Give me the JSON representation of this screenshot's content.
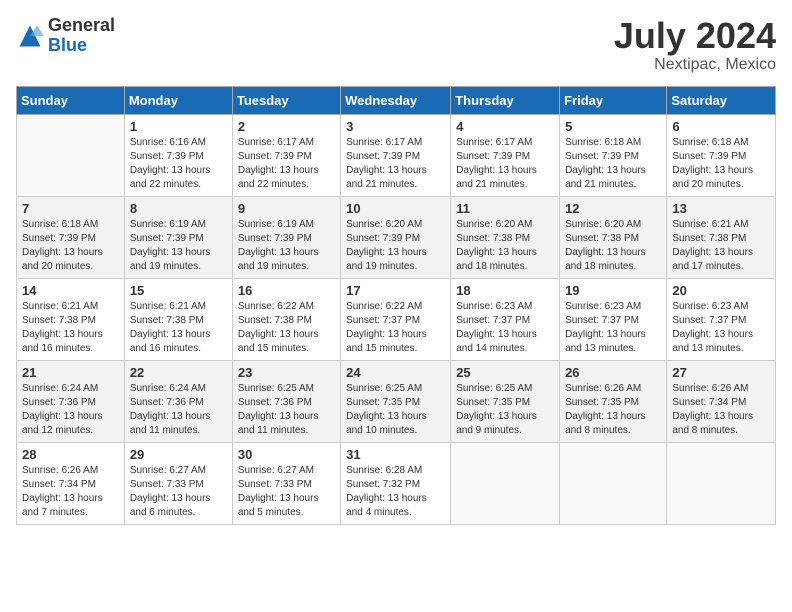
{
  "header": {
    "logo_general": "General",
    "logo_blue": "Blue",
    "month_title": "July 2024",
    "location": "Nextipac, Mexico"
  },
  "days_of_week": [
    "Sunday",
    "Monday",
    "Tuesday",
    "Wednesday",
    "Thursday",
    "Friday",
    "Saturday"
  ],
  "weeks": [
    [
      {
        "day": "",
        "sunrise": "",
        "sunset": "",
        "daylight": ""
      },
      {
        "day": "1",
        "sunrise": "6:16 AM",
        "sunset": "7:39 PM",
        "daylight": "13 hours and 22 minutes."
      },
      {
        "day": "2",
        "sunrise": "6:17 AM",
        "sunset": "7:39 PM",
        "daylight": "13 hours and 22 minutes."
      },
      {
        "day": "3",
        "sunrise": "6:17 AM",
        "sunset": "7:39 PM",
        "daylight": "13 hours and 21 minutes."
      },
      {
        "day": "4",
        "sunrise": "6:17 AM",
        "sunset": "7:39 PM",
        "daylight": "13 hours and 21 minutes."
      },
      {
        "day": "5",
        "sunrise": "6:18 AM",
        "sunset": "7:39 PM",
        "daylight": "13 hours and 21 minutes."
      },
      {
        "day": "6",
        "sunrise": "6:18 AM",
        "sunset": "7:39 PM",
        "daylight": "13 hours and 20 minutes."
      }
    ],
    [
      {
        "day": "7",
        "sunrise": "6:18 AM",
        "sunset": "7:39 PM",
        "daylight": "13 hours and 20 minutes."
      },
      {
        "day": "8",
        "sunrise": "6:19 AM",
        "sunset": "7:39 PM",
        "daylight": "13 hours and 19 minutes."
      },
      {
        "day": "9",
        "sunrise": "6:19 AM",
        "sunset": "7:39 PM",
        "daylight": "13 hours and 19 minutes."
      },
      {
        "day": "10",
        "sunrise": "6:20 AM",
        "sunset": "7:39 PM",
        "daylight": "13 hours and 19 minutes."
      },
      {
        "day": "11",
        "sunrise": "6:20 AM",
        "sunset": "7:38 PM",
        "daylight": "13 hours and 18 minutes."
      },
      {
        "day": "12",
        "sunrise": "6:20 AM",
        "sunset": "7:38 PM",
        "daylight": "13 hours and 18 minutes."
      },
      {
        "day": "13",
        "sunrise": "6:21 AM",
        "sunset": "7:38 PM",
        "daylight": "13 hours and 17 minutes."
      }
    ],
    [
      {
        "day": "14",
        "sunrise": "6:21 AM",
        "sunset": "7:38 PM",
        "daylight": "13 hours and 16 minutes."
      },
      {
        "day": "15",
        "sunrise": "6:21 AM",
        "sunset": "7:38 PM",
        "daylight": "13 hours and 16 minutes."
      },
      {
        "day": "16",
        "sunrise": "6:22 AM",
        "sunset": "7:38 PM",
        "daylight": "13 hours and 15 minutes."
      },
      {
        "day": "17",
        "sunrise": "6:22 AM",
        "sunset": "7:37 PM",
        "daylight": "13 hours and 15 minutes."
      },
      {
        "day": "18",
        "sunrise": "6:23 AM",
        "sunset": "7:37 PM",
        "daylight": "13 hours and 14 minutes."
      },
      {
        "day": "19",
        "sunrise": "6:23 AM",
        "sunset": "7:37 PM",
        "daylight": "13 hours and 13 minutes."
      },
      {
        "day": "20",
        "sunrise": "6:23 AM",
        "sunset": "7:37 PM",
        "daylight": "13 hours and 13 minutes."
      }
    ],
    [
      {
        "day": "21",
        "sunrise": "6:24 AM",
        "sunset": "7:36 PM",
        "daylight": "13 hours and 12 minutes."
      },
      {
        "day": "22",
        "sunrise": "6:24 AM",
        "sunset": "7:36 PM",
        "daylight": "13 hours and 11 minutes."
      },
      {
        "day": "23",
        "sunrise": "6:25 AM",
        "sunset": "7:36 PM",
        "daylight": "13 hours and 11 minutes."
      },
      {
        "day": "24",
        "sunrise": "6:25 AM",
        "sunset": "7:35 PM",
        "daylight": "13 hours and 10 minutes."
      },
      {
        "day": "25",
        "sunrise": "6:25 AM",
        "sunset": "7:35 PM",
        "daylight": "13 hours and 9 minutes."
      },
      {
        "day": "26",
        "sunrise": "6:26 AM",
        "sunset": "7:35 PM",
        "daylight": "13 hours and 8 minutes."
      },
      {
        "day": "27",
        "sunrise": "6:26 AM",
        "sunset": "7:34 PM",
        "daylight": "13 hours and 8 minutes."
      }
    ],
    [
      {
        "day": "28",
        "sunrise": "6:26 AM",
        "sunset": "7:34 PM",
        "daylight": "13 hours and 7 minutes."
      },
      {
        "day": "29",
        "sunrise": "6:27 AM",
        "sunset": "7:33 PM",
        "daylight": "13 hours and 6 minutes."
      },
      {
        "day": "30",
        "sunrise": "6:27 AM",
        "sunset": "7:33 PM",
        "daylight": "13 hours and 5 minutes."
      },
      {
        "day": "31",
        "sunrise": "6:28 AM",
        "sunset": "7:32 PM",
        "daylight": "13 hours and 4 minutes."
      },
      {
        "day": "",
        "sunrise": "",
        "sunset": "",
        "daylight": ""
      },
      {
        "day": "",
        "sunrise": "",
        "sunset": "",
        "daylight": ""
      },
      {
        "day": "",
        "sunrise": "",
        "sunset": "",
        "daylight": ""
      }
    ]
  ],
  "labels": {
    "sunrise_prefix": "Sunrise: ",
    "sunset_prefix": "Sunset: ",
    "daylight_prefix": "Daylight: "
  }
}
